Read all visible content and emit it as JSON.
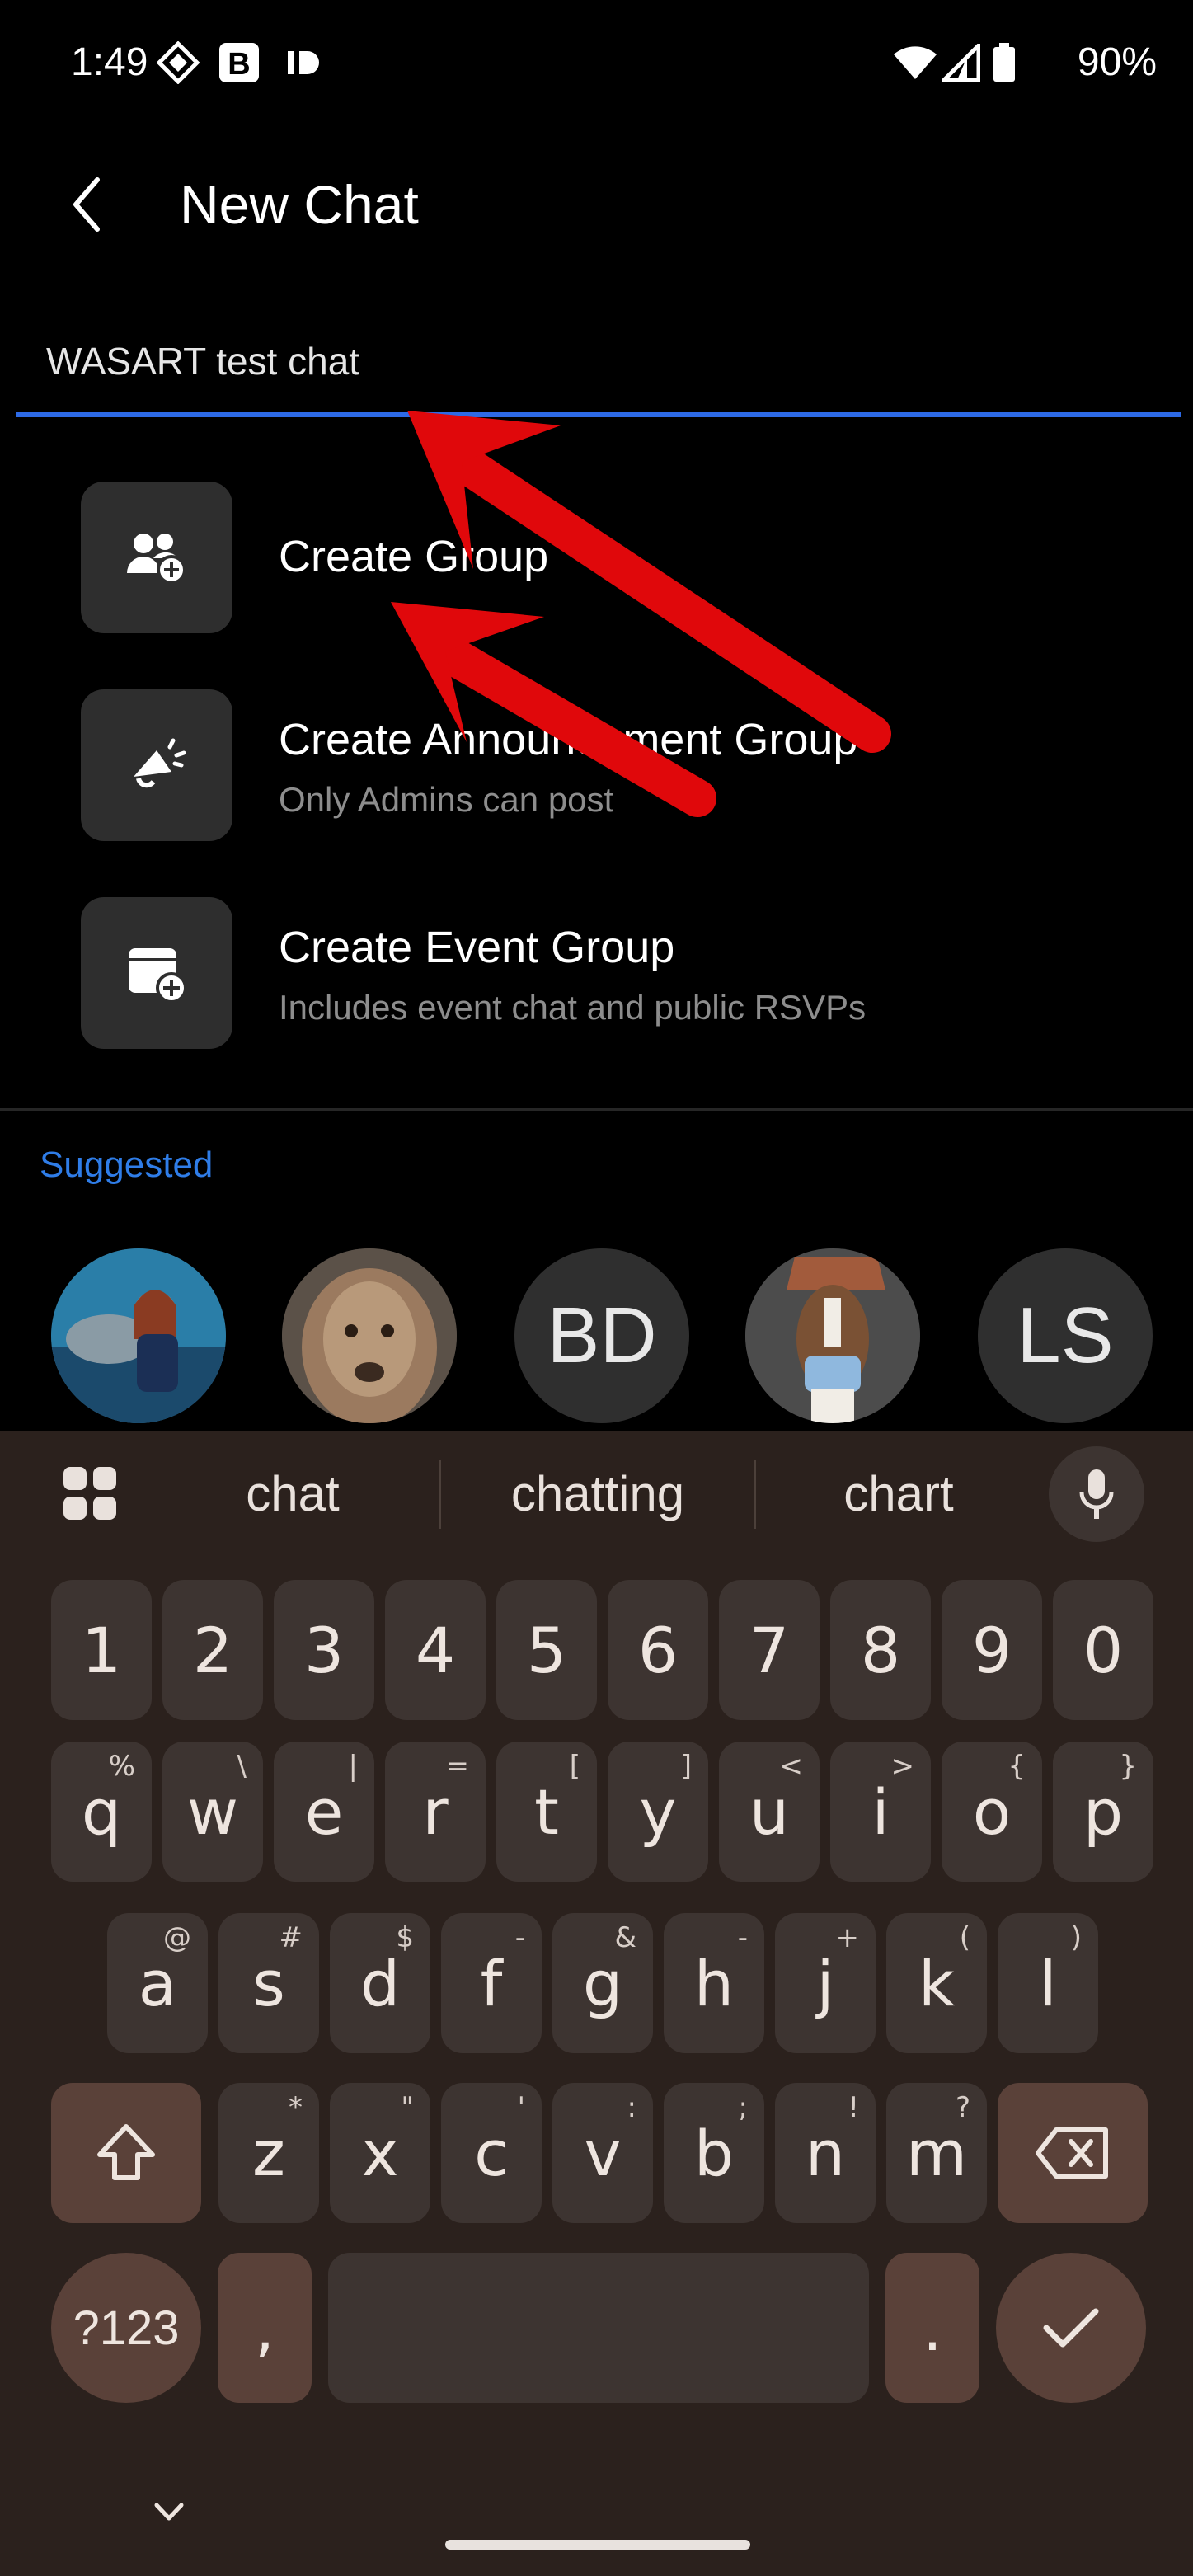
{
  "status_bar": {
    "time": "1:49",
    "battery": "90%"
  },
  "header": {
    "title": "New Chat"
  },
  "search": {
    "value": "WASART test chat"
  },
  "options": [
    {
      "title": "Create Group",
      "subtitle": "",
      "icon": "group-add-icon"
    },
    {
      "title": "Create Announcement Group",
      "subtitle": "Only Admins can post",
      "icon": "megaphone-icon"
    },
    {
      "title": "Create Event Group",
      "subtitle": "Includes event chat and public RSVPs",
      "icon": "calendar-add-icon"
    }
  ],
  "suggested": {
    "label": "Suggested",
    "contacts": [
      {
        "initials": "",
        "type": "photo-dolphin"
      },
      {
        "initials": "",
        "type": "photo-dog"
      },
      {
        "initials": "BD",
        "type": "initials"
      },
      {
        "initials": "",
        "type": "photo-dog-mask"
      },
      {
        "initials": "LS",
        "type": "initials"
      }
    ]
  },
  "keyboard": {
    "suggestions": [
      "chat",
      "chatting",
      "chart"
    ],
    "number_row": [
      "1",
      "2",
      "3",
      "4",
      "5",
      "6",
      "7",
      "8",
      "9",
      "0"
    ],
    "row1": [
      {
        "k": "q",
        "h": "%"
      },
      {
        "k": "w",
        "h": "\\"
      },
      {
        "k": "e",
        "h": "|"
      },
      {
        "k": "r",
        "h": "="
      },
      {
        "k": "t",
        "h": "["
      },
      {
        "k": "y",
        "h": "]"
      },
      {
        "k": "u",
        "h": "<"
      },
      {
        "k": "i",
        "h": ">"
      },
      {
        "k": "o",
        "h": "{"
      },
      {
        "k": "p",
        "h": "}"
      }
    ],
    "row2": [
      {
        "k": "a",
        "h": "@"
      },
      {
        "k": "s",
        "h": "#"
      },
      {
        "k": "d",
        "h": "$"
      },
      {
        "k": "f",
        "h": "-"
      },
      {
        "k": "g",
        "h": "&"
      },
      {
        "k": "h",
        "h": "-"
      },
      {
        "k": "j",
        "h": "+"
      },
      {
        "k": "k",
        "h": "("
      },
      {
        "k": "l",
        "h": ")"
      }
    ],
    "row3": [
      {
        "k": "z",
        "h": "*"
      },
      {
        "k": "x",
        "h": "\""
      },
      {
        "k": "c",
        "h": "'"
      },
      {
        "k": "v",
        "h": ":"
      },
      {
        "k": "b",
        "h": ";"
      },
      {
        "k": "n",
        "h": "!"
      },
      {
        "k": "m",
        "h": "?"
      }
    ],
    "symbols_label": "?123",
    "comma": ",",
    "period": "."
  },
  "colors": {
    "accent": "#2d6ae6",
    "annotation_arrow": "#e0080b",
    "keyboard_bg": "#2b211d",
    "key_bg": "#3d3431",
    "fn_key_bg": "#5a4139"
  }
}
